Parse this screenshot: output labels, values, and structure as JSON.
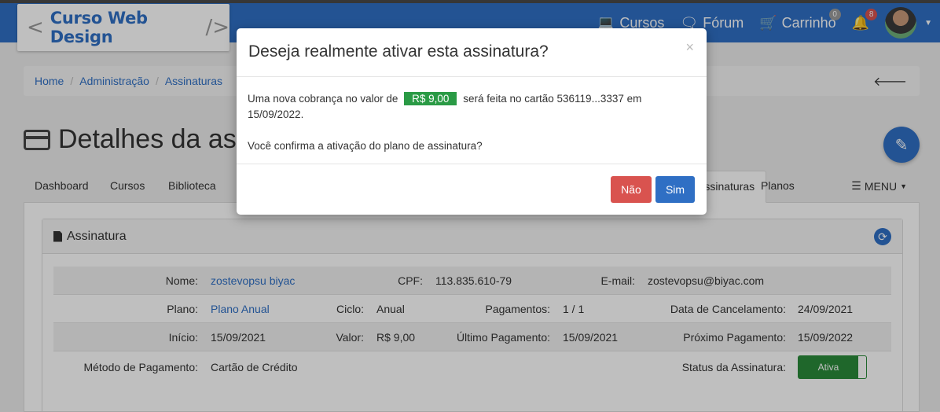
{
  "header": {
    "brand": "Curso Web Design",
    "brand_left": "<",
    "brand_right": "/>",
    "nav": {
      "cursos": "Cursos",
      "forum": "Fórum",
      "carrinho": "Carrinho",
      "cart_count": "0",
      "notif_count": "8"
    }
  },
  "breadcrumb": [
    "Home",
    "Administração",
    "Assinaturas"
  ],
  "page": {
    "title": "Detalhes da assinatura"
  },
  "tabs": {
    "dashboard": "Dashboard",
    "cursos": "Cursos",
    "biblioteca": "Biblioteca",
    "assinaturas": "Assinaturas",
    "planos": "Planos",
    "menu": "MENU"
  },
  "panel": {
    "title": "Assinatura",
    "fields": {
      "nome_label": "Nome:",
      "nome": "zostevopsu biyac",
      "cpf_label": "CPF:",
      "cpf": "113.835.610-79",
      "email_label": "E-mail:",
      "email": "zostevopsu@biyac.com",
      "plano_label": "Plano:",
      "plano": "Plano Anual",
      "ciclo_label": "Ciclo:",
      "ciclo": "Anual",
      "pagamentos_label": "Pagamentos:",
      "pagamentos": "1 / 1",
      "cancelamento_label": "Data de Cancelamento:",
      "cancelamento": "24/09/2021",
      "inicio_label": "Início:",
      "inicio": "15/09/2021",
      "valor_label": "Valor:",
      "valor": "R$ 9,00",
      "ultimo_label": "Último Pagamento:",
      "ultimo": "15/09/2021",
      "proximo_label": "Próximo Pagamento:",
      "proximo": "15/09/2022",
      "metodo_label": "Método de Pagamento:",
      "metodo": "Cartão de Crédito",
      "status_label": "Status da Assinatura:",
      "status": "Ativa"
    }
  },
  "modal": {
    "title": "Deseja realmente ativar esta assinatura?",
    "close": "×",
    "text_before": "Uma nova cobrança no valor de",
    "price": "R$ 9,00",
    "text_after": "será feita no cartão 536119...3337 em 15/09/2022.",
    "confirm_text": "Você confirma a ativação do plano de assinatura?",
    "no_label": "Não",
    "yes_label": "Sim"
  },
  "colors": {
    "primary": "#2f6fc4",
    "danger": "#d9534f",
    "success": "#2a9a45"
  }
}
